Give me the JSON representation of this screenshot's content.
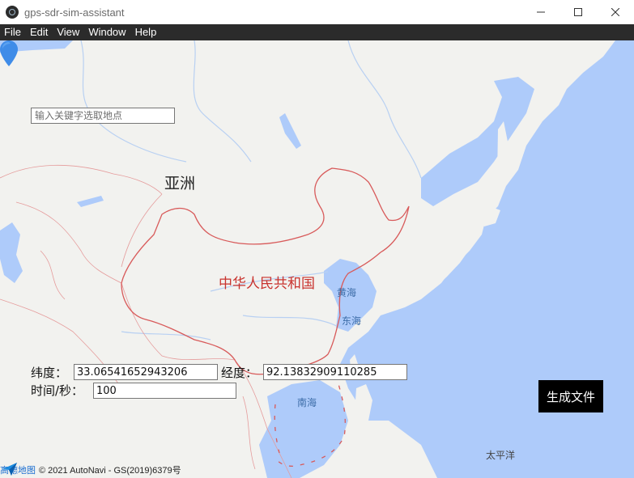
{
  "window": {
    "title": "gps-sdr-sim-assistant",
    "controls": {
      "minimize": "minimize-icon",
      "maximize": "maximize-icon",
      "close": "close-icon"
    }
  },
  "menu": [
    {
      "label": "File"
    },
    {
      "label": "Edit"
    },
    {
      "label": "View"
    },
    {
      "label": "Window"
    },
    {
      "label": "Help"
    }
  ],
  "map": {
    "search_placeholder": "输入关键字选取地点",
    "labels": {
      "asia": "亚洲",
      "china": "中华人民共和国",
      "huanghai": "黄海",
      "donghai": "东海",
      "nanhai": "南海",
      "pacific": "太平洋"
    },
    "marker_icon": "location-pin-icon",
    "attribution": {
      "brand": "高德地图",
      "text": "© 2021 AutoNavi - GS(2019)6379号"
    },
    "colors": {
      "land": "#f2f2ef",
      "water": "#aecbfa",
      "border": "#e27272",
      "pin": "#3f8ce8",
      "china_label": "#c9332e"
    }
  },
  "form": {
    "lat_label": "纬度：",
    "lat_value": "33.06541652943206",
    "lng_label": "经度：",
    "lng_value": "92.13832909110285",
    "time_label": "时间/秒：",
    "time_value": "100",
    "generate_button": "生成文件"
  }
}
